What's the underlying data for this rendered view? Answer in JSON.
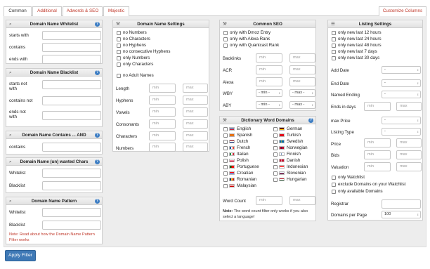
{
  "tabs": [
    "Common",
    "Additional",
    "Adwords & SEO",
    "Majestic"
  ],
  "customize": "Customize Columns",
  "placeholders": {
    "min": "min",
    "max": "max",
    "dash": "-",
    "minsel": "- min -",
    "maxsel": "- max -"
  },
  "whitelist": {
    "title": "Domain Name Whitelist",
    "labels": [
      "starts with",
      "contains",
      "ends with"
    ]
  },
  "blacklist": {
    "title": "Domain Name Blacklist",
    "labels": [
      "starts not with",
      "contains not",
      "ends not with"
    ]
  },
  "contains_and": {
    "title": "Domain Name Contains ... AND",
    "labels": [
      "contains"
    ]
  },
  "wanted_chars": {
    "title": "Domain Name (un) wanted Chars",
    "labels": [
      "Whitelist",
      "Blacklist"
    ]
  },
  "pattern": {
    "title": "Domain Name Pattern",
    "labels": [
      "Whitelist",
      "Blacklist"
    ],
    "note": "Note: Read about how the Domain Name Pattern Filter works"
  },
  "settings": {
    "title": "Domain Name Settings",
    "checks": [
      "no Numbers",
      "no Characters",
      "no Hyphens",
      "no consecutive Hyphens",
      "only Numbers",
      "only Characters",
      "no Adult Names"
    ],
    "rows": [
      "Length",
      "Hyphens",
      "Vowels",
      "Consonants",
      "Characters",
      "Numbers"
    ]
  },
  "seo": {
    "title": "Common SEO",
    "checks": [
      "only with Dmoz Entry",
      "only with Alexa Rank",
      "only with Quantcast Rank"
    ],
    "rows": [
      "Backlinks",
      "ACR",
      "Alexa",
      "WBY",
      "ABY"
    ]
  },
  "dictionary": {
    "title": "Dictionary Word Domains",
    "left": [
      "English",
      "Spanish",
      "Dutch",
      "French",
      "Italian",
      "Polish",
      "Portuguese",
      "Croatian",
      "Romanian",
      "Malaysian"
    ],
    "right": [
      "German",
      "Turkish",
      "Swedish",
      "Norwegian",
      "Finnish",
      "Danish",
      "Indonesian",
      "Slovenian",
      "Hungarian"
    ],
    "word_count": "Word Count",
    "note_bold": "Note:",
    "note": "The word count filter only works if you also select a language!"
  },
  "listing": {
    "title": "Listing Settings",
    "checks": [
      "only new last 12 hours",
      "only new last 24 hours",
      "only new last 48 hours",
      "only new last 7 days",
      "only new last 30 days"
    ],
    "selects": [
      "Add Date",
      "End Date",
      "Named Ending"
    ],
    "ends_in": "Ends in days",
    "selects2": [
      "max Price",
      "Listing Type"
    ],
    "rows": [
      "Price",
      "Bids",
      "Valuation"
    ],
    "checks2": [
      "only Watchlist",
      "exclude Domains on your Watchlist",
      "only available Domains"
    ],
    "registrar": "Registrar",
    "per_page": "Domains per Page",
    "per_page_value": "100"
  },
  "apply": "Apply Filter"
}
